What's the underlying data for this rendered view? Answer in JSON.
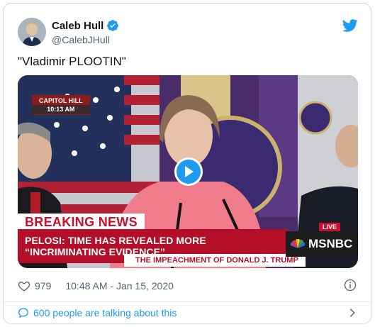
{
  "author": {
    "name": "Caleb Hull",
    "handle": "@CalebJHull"
  },
  "tweet": {
    "text": "\"Vladimir PLOOTIN\""
  },
  "video": {
    "location_label": "CAPITOL HILL",
    "time_label": "10:13 AM",
    "breaking_label": "BREAKING NEWS",
    "headline": "PELOSI: TIME HAS REVEALED MORE “INCRIMINATING EVIDENCE”",
    "subline": "THE IMPEACHMENT OF DONALD J. TRUMP",
    "live_label": "LIVE",
    "network_label": "MSNBC"
  },
  "meta": {
    "likes": "979",
    "timestamp": "10:48 AM - Jan 15, 2020"
  },
  "conversation": {
    "label": "600 people are talking about this"
  },
  "colors": {
    "accent": "#1d9bf0",
    "breaking_red": "#b50e28"
  }
}
